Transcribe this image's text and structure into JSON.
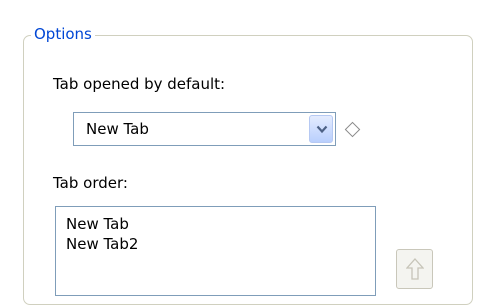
{
  "options_group": {
    "legend": "Options",
    "default_tab_label": "Tab opened by default:",
    "default_tab_value": "New Tab",
    "tab_order_label": "Tab order:",
    "tab_order_items": [
      "New Tab",
      "New Tab2"
    ]
  },
  "colors": {
    "legend_text": "#0046d5",
    "input_border": "#7f9db9",
    "group_border": "#d0d0bf"
  },
  "icons": {
    "dropdown": "chevron-down-icon",
    "indicator": "diamond-icon",
    "move_up": "arrow-up-icon"
  }
}
